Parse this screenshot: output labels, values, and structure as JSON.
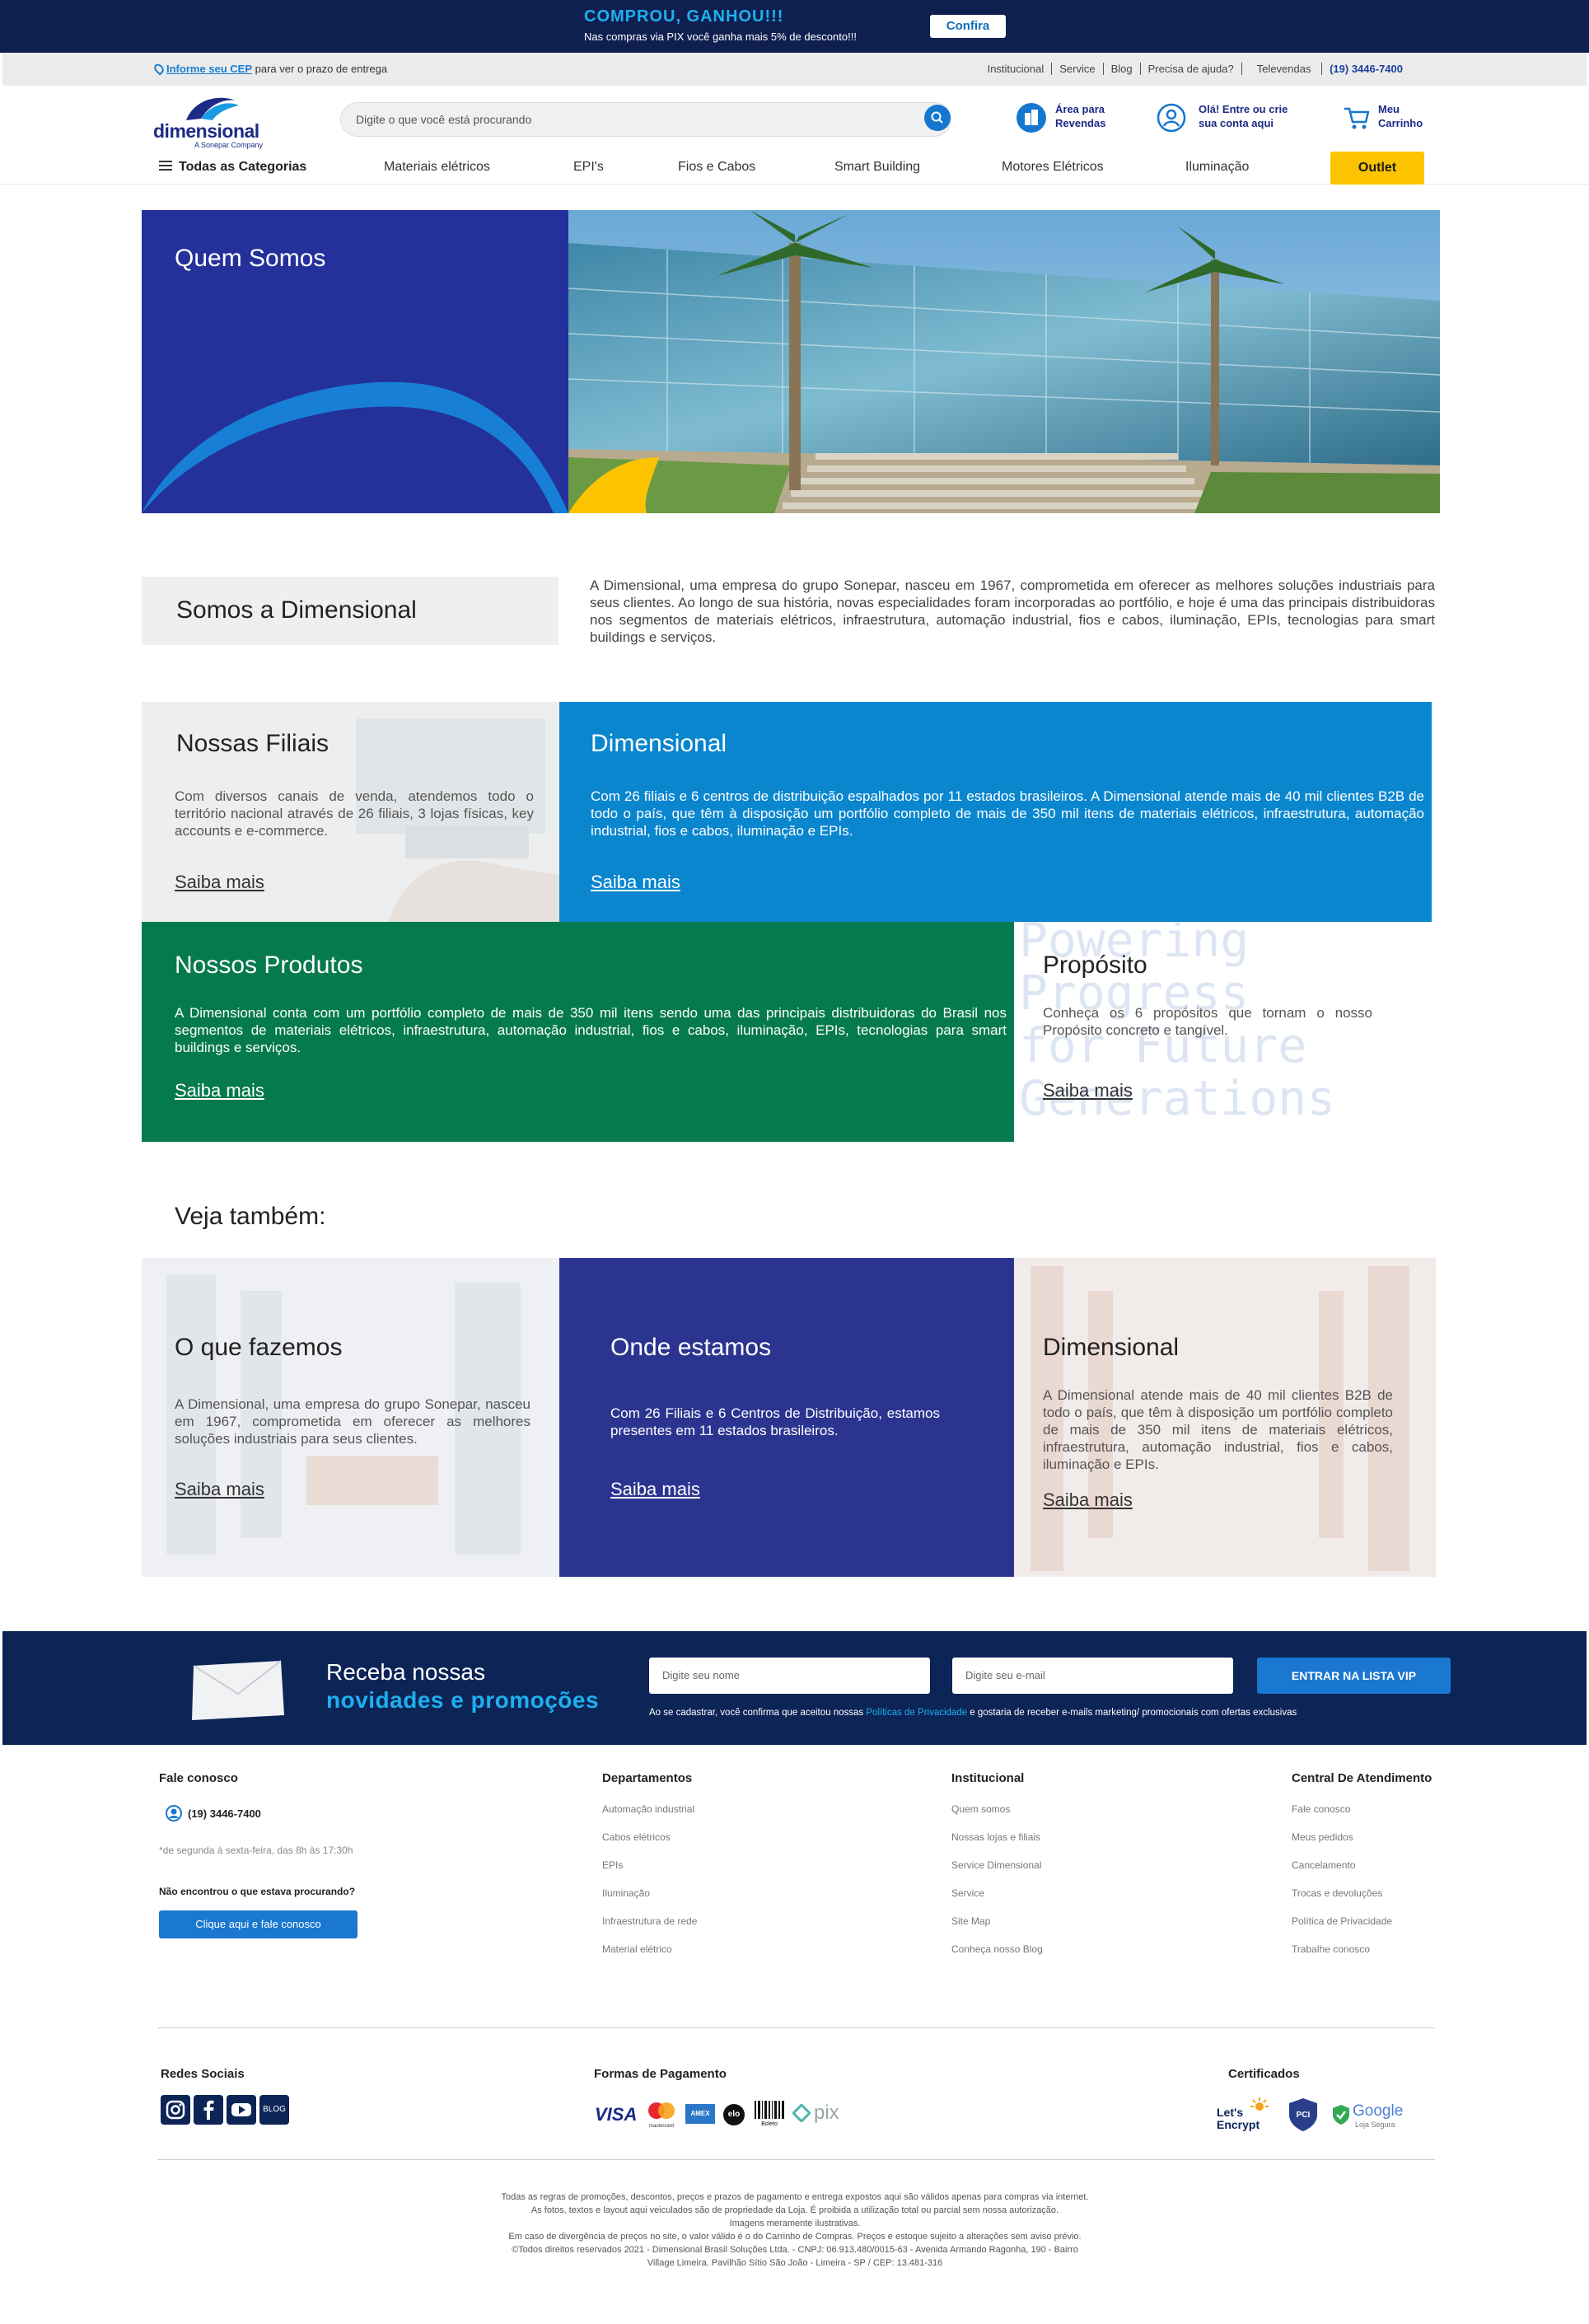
{
  "promo": {
    "title": "COMPROU, GANHOU!!!",
    "subtitle": "Nas compras via PIX você ganha mais 5% de desconto!!!",
    "button": "Confira"
  },
  "utility": {
    "cep_link": "Informe seu CEP",
    "cep_text": " para ver o prazo de entrega",
    "links": [
      "Institucional",
      "Service",
      "Blog",
      "Precisa de ajuda?"
    ],
    "televendas_label": "Televendas ",
    "televendas_phone": "(19) 3446-7400"
  },
  "header": {
    "logo_word": "dimensional",
    "logo_tag": "A Sonepar Company",
    "search_placeholder": "Digite o que você está procurando",
    "revendas_l1": "Área para",
    "revendas_l2": "Revendas",
    "account_l1": "Olá! Entre ou crie",
    "account_l2": "sua conta aqui",
    "cart_l1": "Meu",
    "cart_l2": "Carrinho"
  },
  "nav": {
    "all": "Todas as Categorias",
    "items": [
      "Materiais elétricos",
      "EPI's",
      "Fios e Cabos",
      "Smart Building",
      "Motores Elétricos",
      "Iluminação"
    ],
    "outlet": "Outlet"
  },
  "hero": {
    "title": "Quem Somos"
  },
  "about": {
    "title": "Somos a Dimensional",
    "text": "A Dimensional, uma empresa do grupo Sonepar, nasceu em 1967, comprometida em oferecer as melhores soluções industriais para seus clientes. Ao longo de sua história, novas especialidades foram incorporadas ao portfólio, e hoje é uma das principais distribuidoras nos segmentos de materiais elétricos, infraestrutura, automação industrial, fios e cabos, iluminação, EPIs, tecnologias para smart buildings e serviços."
  },
  "cards": {
    "filiais": {
      "title": "Nossas Filiais",
      "text": "Com diversos canais de venda, atendemos todo o território nacional através de 26 filiais, 3 lojas físicas, key accounts e e-commerce.",
      "link": "Saiba mais"
    },
    "dimensional": {
      "title": "Dimensional",
      "text": "Com 26 filiais e 6 centros de distribuição espalhados por 11 estados brasileiros. A Dimensional atende mais de 40 mil clientes B2B de todo o país, que têm à disposição um portfólio completo de mais de 350 mil itens de materiais elétricos, infraestrutura, automação industrial, fios e cabos, iluminação e EPIs.",
      "link": "Saiba mais"
    },
    "produtos": {
      "title": "Nossos Produtos",
      "text": "A Dimensional conta com um portfólio completo de mais de 350 mil itens sendo uma das principais distribuidoras do Brasil nos segmentos de materiais elétricos, infraestrutura, automação industrial, fios e cabos, iluminação, EPIs, tecnologias para smart buildings e serviços.",
      "link": "Saiba mais"
    },
    "proposito": {
      "title": "Propósito",
      "text": "Conheça os 6 propósitos que tornam o nosso Propósito concreto e tangível.",
      "link": "Saiba mais",
      "watermark": [
        "Powering",
        "Progress",
        "for Future",
        "Generations"
      ]
    }
  },
  "see_also": {
    "title": "Veja também:",
    "fazemos": {
      "title": "O que fazemos",
      "text": "A Dimensional, uma empresa do grupo Sonepar, nasceu em 1967, comprometida em oferecer as melhores soluções industriais para seus clientes.",
      "link": "Saiba mais"
    },
    "estamos": {
      "title": "Onde estamos",
      "text": "Com 26 Filiais e 6 Centros de Distribuição, estamos presentes em 11 estados brasileiros.",
      "link": "Saiba mais"
    },
    "dimensional": {
      "title": "Dimensional",
      "text": "A Dimensional atende mais de 40 mil clientes B2B de todo o país, que têm à disposição um portfólio completo de mais de 350 mil itens de materiais elétricos, infraestrutura, automação industrial, fios e cabos, iluminação e EPIs.",
      "link": "Saiba mais"
    }
  },
  "newsletter": {
    "line1": "Receba nossas",
    "line2": "novidades e promoções",
    "name_placeholder": "Digite seu nome",
    "email_placeholder": "Digite seu e-mail",
    "button": "ENTRAR NA LISTA VIP",
    "disc_pre": "Ao se cadastrar, você confirma que aceitou nossas ",
    "disc_link": "Políticas de Privacidade",
    "disc_post": " e gostaria de receber e-mails marketing/ promocionais com ofertas exclusivas"
  },
  "footer": {
    "contact_title": "Fale conosco",
    "phone": "(19) 3446-7400",
    "hours": "*de segunda à sexta-feira, das 8h às 17:30h",
    "not_found": "Não encontrou o que estava procurando?",
    "contact_btn": "Clique aqui e fale conosco",
    "dept_title": "Departamentos",
    "dept": [
      "Automação industrial",
      "Cabos elétricos",
      "EPIs",
      "Iluminação",
      "Infraestrutura de rede",
      "Material elétrico"
    ],
    "inst_title": "Institucional",
    "inst": [
      "Quem somos",
      "Nossas lojas e filiais",
      "Service Dimensional",
      "Service",
      "Site Map",
      "Conheça nosso Blog"
    ],
    "central_title": "Central De Atendimento",
    "central": [
      "Fale conosco",
      "Meus pedidos",
      "Cancelamento",
      "Trocas e devoluções",
      "Política de Privacidade",
      "Trabalhe conosco"
    ],
    "social_title": "Redes Sociais",
    "blog_badge": "BLOG",
    "pay_title": "Formas de Pagamento",
    "pay": {
      "visa": "VISA",
      "master": "mastercard",
      "amex": "AMEX",
      "elo": "elo",
      "boleto": "Boleto",
      "pix": "pix"
    },
    "cert_title": "Certificados",
    "cert": {
      "le1": "Let's",
      "le2": "Encrypt",
      "pci": "PCI",
      "google": "Google",
      "google_sub": "Loja Segura"
    },
    "legal": [
      "Todas as regras de promoções, descontos, preços e prazos de pagamento e entrega expostos aqui são válidos apenas para compras via internet.",
      "As fotos, textos e layout aqui veiculados são de propriedade da Loja. É proibida a utilização total ou parcial sem nossa autorização.",
      "Imagens meramente ilustrativas.",
      "Em caso de divergência de preços no site, o valor válido é o do Carrinho de Compras. Preços e estoque sujeito a alterações sem aviso prévio.",
      "©Todos direitos reservados 2021 - Dimensional Brasil Soluções Ltda. - CNPJ: 06.913.480/0015-63 - Avenida Armando Ragonha, 190 - Bairro",
      "Village Limeira. Pavilhão Sítio São João - Limeira - SP / CEP: 13.481-316"
    ]
  },
  "colors": {
    "navy": "#0f2050",
    "brand_blue": "#24319a",
    "light_blue": "#0a86cf",
    "green": "#067a4f",
    "accent_yellow": "#fcc400",
    "cyan": "#1db0f0"
  }
}
